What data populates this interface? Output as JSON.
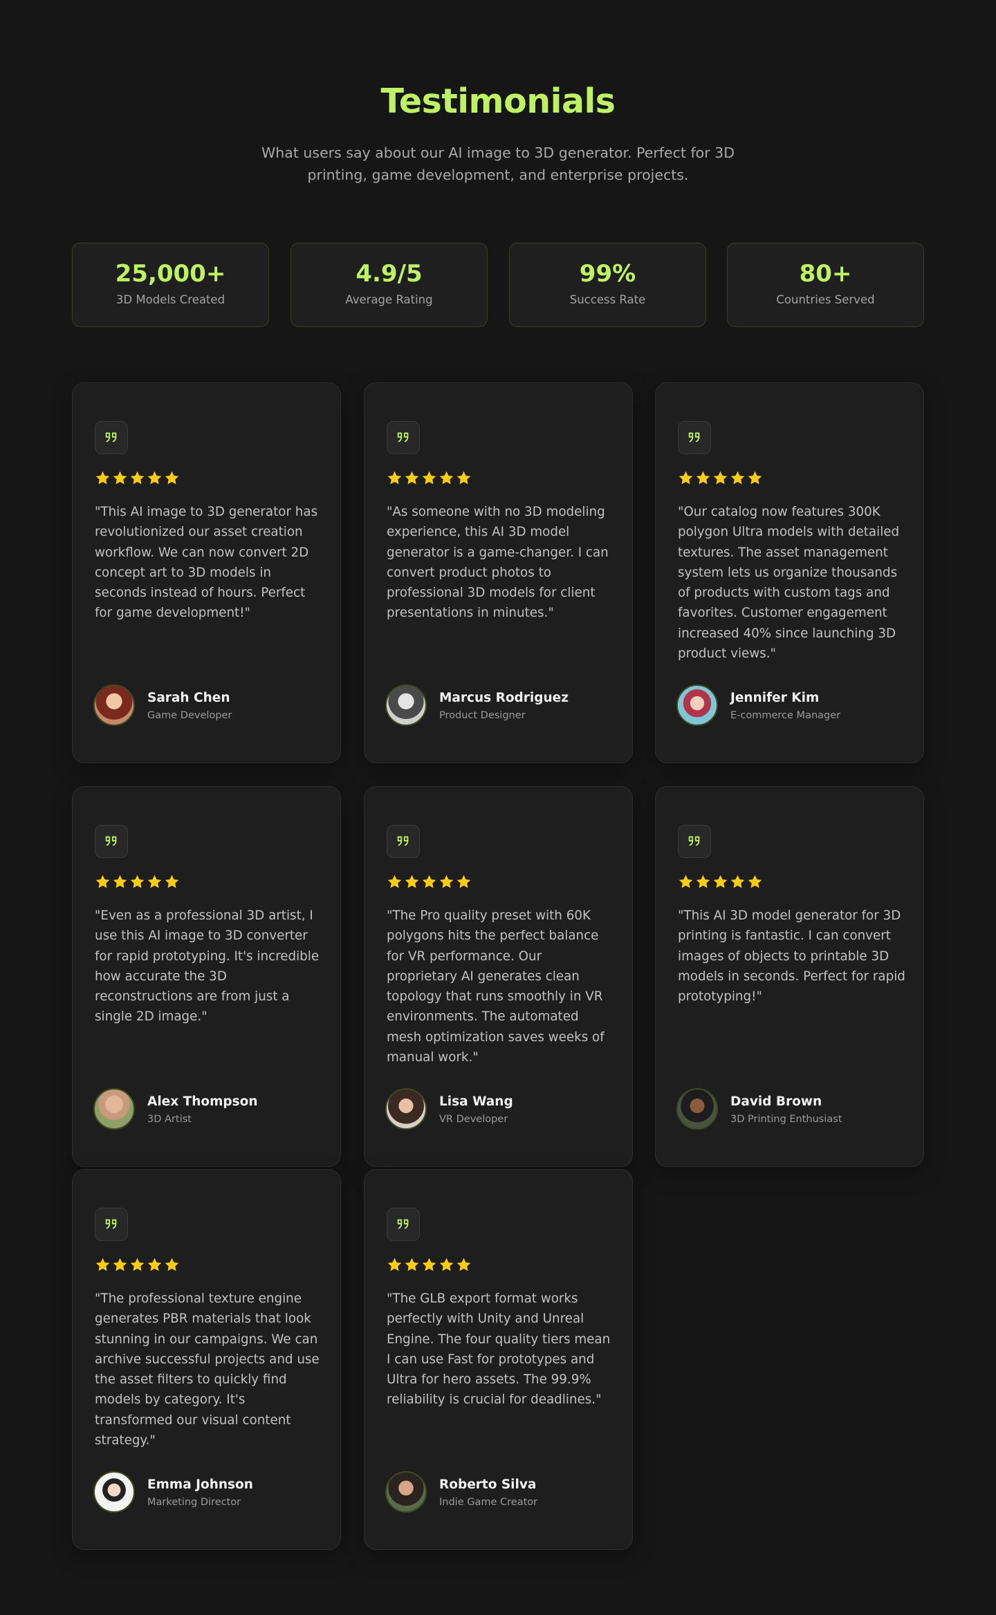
{
  "header": {
    "title": "Testimonials",
    "subtitle": "What users say about our AI image to 3D generator. Perfect for 3D printing, game development, and enterprise projects."
  },
  "stats": [
    {
      "value": "25,000+",
      "label": "3D Models Created"
    },
    {
      "value": "4.9/5",
      "label": "Average Rating"
    },
    {
      "value": "99%",
      "label": "Success Rate"
    },
    {
      "value": "80+",
      "label": "Countries Served"
    }
  ],
  "colors": {
    "accent": "#bef264",
    "star": "#facc15",
    "background": "#161616",
    "card": "#1e1e1e"
  },
  "icons": {
    "quote": "quote-icon",
    "star": "star-icon"
  },
  "testimonials": [
    {
      "rating": 5,
      "quote": "\"This AI image to 3D generator has revolutionized our asset creation workflow. We can now convert 2D concept art to 3D models in seconds instead of hours. Perfect for game development!\"",
      "name": "Sarah Chen",
      "role": "Game Developer"
    },
    {
      "rating": 5,
      "quote": "\"As someone with no 3D modeling experience, this AI 3D model generator is a game-changer. I can convert product photos to professional 3D models for client presentations in minutes.\"",
      "name": "Marcus Rodriguez",
      "role": "Product Designer"
    },
    {
      "rating": 5,
      "quote": "\"Our catalog now features 300K polygon Ultra models with detailed textures. The asset management system lets us organize thousands of products with custom tags and favorites. Customer engagement increased 40% since launching 3D product views.\"",
      "name": "Jennifer Kim",
      "role": "E-commerce Manager"
    },
    {
      "rating": 5,
      "quote": "\"Even as a professional 3D artist, I use this AI image to 3D converter for rapid prototyping. It's incredible how accurate the 3D reconstructions are from just a single 2D image.\"",
      "name": "Alex Thompson",
      "role": "3D Artist"
    },
    {
      "rating": 5,
      "quote": "\"The Pro quality preset with 60K polygons hits the perfect balance for VR performance. Our proprietary AI generates clean topology that runs smoothly in VR environments. The automated mesh optimization saves weeks of manual work.\"",
      "name": "Lisa Wang",
      "role": "VR Developer"
    },
    {
      "rating": 5,
      "quote": "\"This AI 3D model generator for 3D printing is fantastic. I can convert images of objects to printable 3D models in seconds. Perfect for rapid prototyping!\"",
      "name": "David Brown",
      "role": "3D Printing Enthusiast"
    },
    {
      "rating": 5,
      "quote": "\"The professional texture engine generates PBR materials that look stunning in our campaigns. We can archive successful projects and use the asset filters to quickly find models by category. It's transformed our visual content strategy.\"",
      "name": "Emma Johnson",
      "role": "Marketing Director"
    },
    {
      "rating": 5,
      "quote": "\"The GLB export format works perfectly with Unity and Unreal Engine. The four quality tiers mean I can use Fast for prototypes and Ultra for hero assets. The 99.9% reliability is crucial for deadlines.\"",
      "name": "Roberto Silva",
      "role": "Indie Game Creator"
    }
  ]
}
